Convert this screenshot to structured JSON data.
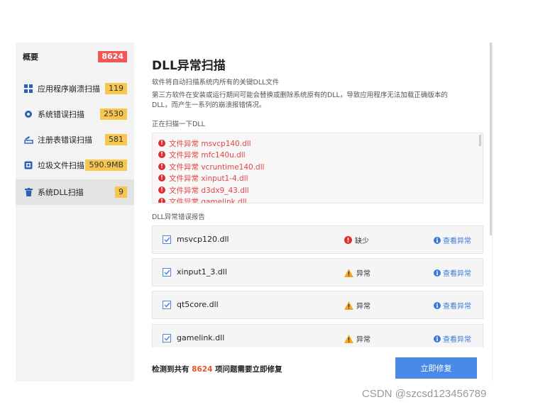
{
  "sidebar": {
    "items": [
      {
        "label": "概要",
        "badge": "8624",
        "icon": "none"
      },
      {
        "label": "应用程序崩溃扫描",
        "badge": "119",
        "icon": "grid-icon"
      },
      {
        "label": "系统错误扫描",
        "badge": "2530",
        "icon": "gear-icon"
      },
      {
        "label": "注册表错误扫描",
        "badge": "581",
        "icon": "registry-icon"
      },
      {
        "label": "垃圾文件扫描",
        "badge": "590.9MB",
        "icon": "cleanup-icon"
      },
      {
        "label": "系统DLL扫描",
        "badge": "9",
        "icon": "trash-icon"
      }
    ]
  },
  "main": {
    "title": "DLL异常扫描",
    "desc1": "软件将自动扫描系统内所有的关键DLL文件",
    "desc2": "第三方软件在安装或运行期间可能会替换或删除系统原有的DLL，导致应用程序无法加载正确版本的",
    "desc3": "DLL，而产生一系列的崩溃报错情况。",
    "scan_label": "正在扫描一下DLL",
    "scan_lines": [
      "文件异常 msvcp140.dll",
      "文件异常 mfc140u.dll",
      "文件异常 vcruntime140.dll",
      "文件异常 xinput1-4.dll",
      "文件异常 d3dx9_43.dll",
      "文件异常 gamelink.dll"
    ],
    "report_label": "DLL异常错误报告",
    "rows": [
      {
        "file": "msvcp120.dll",
        "status": "缺少",
        "status_icon": "missing-icon",
        "action": "查看异常"
      },
      {
        "file": "xinput1_3.dll",
        "status": "异常",
        "status_icon": "warning-icon",
        "action": "查看异常"
      },
      {
        "file": "qt5core.dll",
        "status": "异常",
        "status_icon": "warning-icon",
        "action": "查看异常"
      },
      {
        "file": "gamelink.dll",
        "status": "异常",
        "status_icon": "warning-icon",
        "action": "查看异常"
      }
    ]
  },
  "footer": {
    "prefix": "检测到共有",
    "count": "8624",
    "suffix": "项问题需要立即修复",
    "fix_button": "立即修复"
  },
  "watermark": "CSDN @szcsd123456789",
  "colors": {
    "accent": "#4a8ae6",
    "error": "#e02e2e",
    "warning": "#f5a623",
    "badge": "#f7c74d",
    "badge_red": "#f25757"
  }
}
